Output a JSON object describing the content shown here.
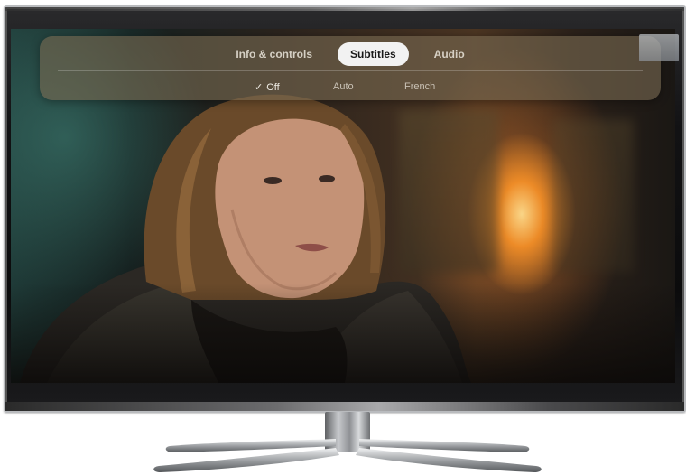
{
  "menu": {
    "tabs": [
      {
        "label": "Info & controls",
        "selected": false
      },
      {
        "label": "Subtitles",
        "selected": true
      },
      {
        "label": "Audio",
        "selected": false
      }
    ],
    "subtitle_options": [
      {
        "label": "Off",
        "checked": true,
        "check_glyph": "✓"
      },
      {
        "label": "Auto",
        "checked": false
      },
      {
        "label": "French",
        "checked": false
      }
    ]
  },
  "colors": {
    "panel": "#78694f",
    "selected_tab_bg": "#f2f2f2",
    "selected_tab_text": "#1a1a1a",
    "tab_text": "#ebe6dc"
  },
  "icons": {
    "check": "checkmark-icon"
  }
}
